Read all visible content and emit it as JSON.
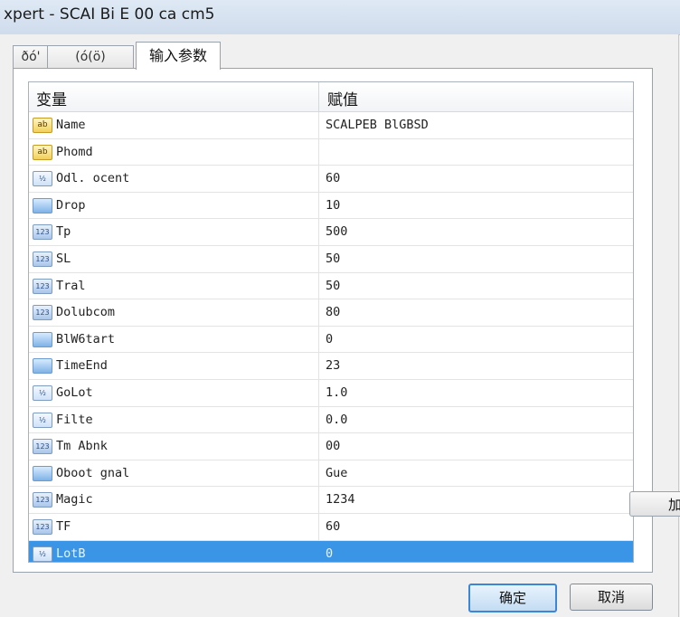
{
  "window": {
    "title": "xpert - SCAI Bi E 00 ca cm5"
  },
  "tabs": [
    {
      "label": "ðó'"
    },
    {
      "label": "(ó(ö)"
    },
    {
      "label": "输入参数"
    }
  ],
  "table": {
    "headers": {
      "variable": "变量",
      "value": "赋值"
    },
    "rows": [
      {
        "icon": "string-icon",
        "name": "Name",
        "value": "SCALPEB BlGBSD",
        "selected": false
      },
      {
        "icon": "string-icon",
        "name": "Phomd",
        "value": "",
        "selected": false
      },
      {
        "icon": "double-icon",
        "name": "Odl.      ocent",
        "value": "60",
        "selected": false
      },
      {
        "icon": "bool-icon",
        "name": "Drop",
        "value": "10",
        "selected": false
      },
      {
        "icon": "int-icon",
        "name": "Tp",
        "value": "500",
        "selected": false
      },
      {
        "icon": "int-icon",
        "name": "SL",
        "value": "50",
        "selected": false
      },
      {
        "icon": "int-icon",
        "name": "Tral",
        "value": "50",
        "selected": false
      },
      {
        "icon": "int-icon",
        "name": "Dolubcom",
        "value": "80",
        "selected": false
      },
      {
        "icon": "bool-icon",
        "name": "BlW6tart",
        "value": "0",
        "selected": false
      },
      {
        "icon": "bool-icon",
        "name": "TimeEnd",
        "value": "23",
        "selected": false
      },
      {
        "icon": "double-icon",
        "name": "GoLot",
        "value": "1.0",
        "selected": false
      },
      {
        "icon": "double-icon",
        "name": "Filte",
        "value": "0.0",
        "selected": false
      },
      {
        "icon": "int-icon",
        "name": "Tm Abnk",
        "value": "00",
        "selected": false
      },
      {
        "icon": "bool-icon",
        "name": "Oboot gnal",
        "value": "Gue",
        "selected": false
      },
      {
        "icon": "int-icon",
        "name": "Magic",
        "value": "1234",
        "selected": false
      },
      {
        "icon": "int-icon",
        "name": "TF",
        "value": "60",
        "selected": false
      },
      {
        "icon": "double-icon",
        "name": "LotB",
        "value": "0",
        "selected": true
      }
    ]
  },
  "buttons": {
    "side": "加",
    "ok": "确定",
    "cancel": "取消"
  },
  "colors": {
    "selection": "#3b95e6",
    "ok_border": "#3c86d8"
  }
}
